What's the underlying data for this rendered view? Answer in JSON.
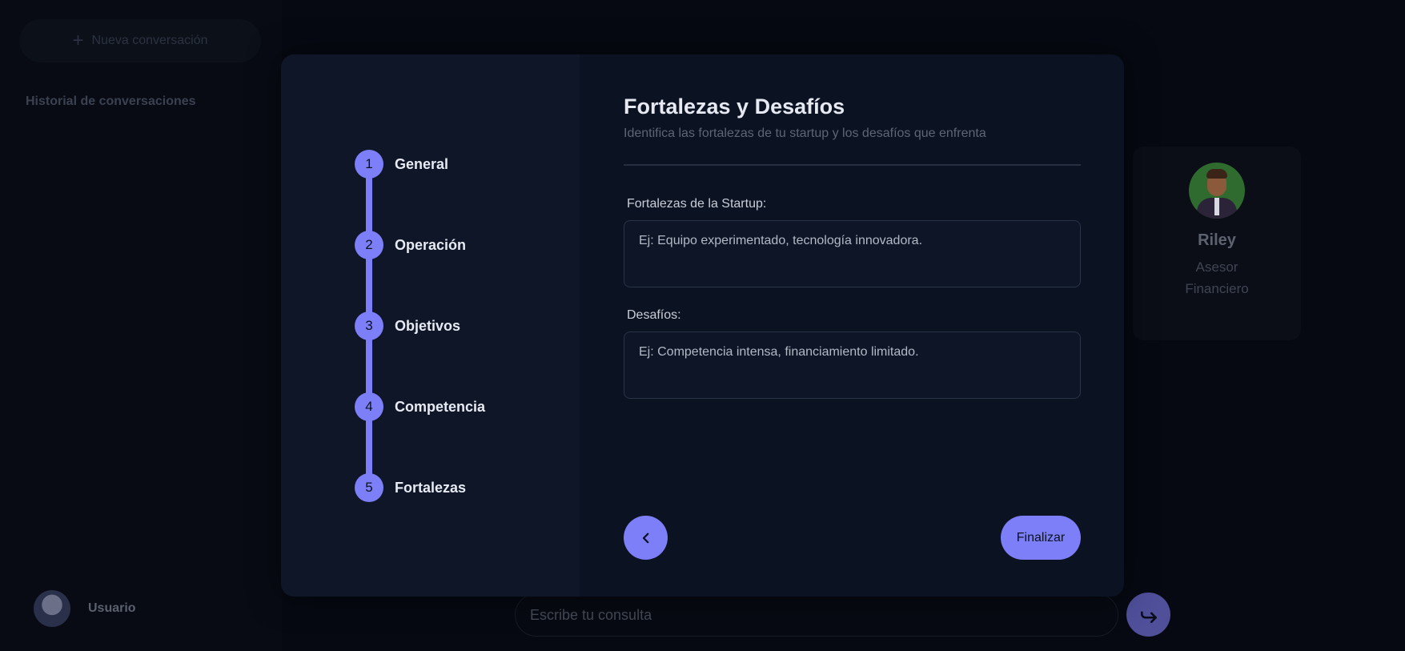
{
  "sidebar": {
    "new_chat_label": "Nueva conversación",
    "history_title": "Historial de conversaciones",
    "user_name": "Usuario"
  },
  "advisor": {
    "name": "Riley",
    "role_line1": "Asesor",
    "role_line2": "Financiero"
  },
  "chat": {
    "placeholder": "Escribe tu consulta"
  },
  "modal": {
    "steps": [
      {
        "number": "1",
        "label": "General"
      },
      {
        "number": "2",
        "label": "Operación"
      },
      {
        "number": "3",
        "label": "Objetivos"
      },
      {
        "number": "4",
        "label": "Competencia"
      },
      {
        "number": "5",
        "label": "Fortalezas"
      }
    ],
    "title": "Fortalezas y Desafíos",
    "subtitle": "Identifica las fortalezas de tu startup y los desafíos que enfrenta",
    "fields": [
      {
        "label": "Fortalezas de la Startup:",
        "placeholder": "Ej: Equipo experimentado, tecnología innovadora."
      },
      {
        "label": "Desafíos:",
        "placeholder": "Ej: Competencia intensa, financiamiento limitado."
      }
    ],
    "finish_label": "Finalizar"
  },
  "colors": {
    "accent": "#7c7ff7",
    "modal_left_bg": "#0e1628",
    "modal_right_bg": "#0b1221"
  }
}
